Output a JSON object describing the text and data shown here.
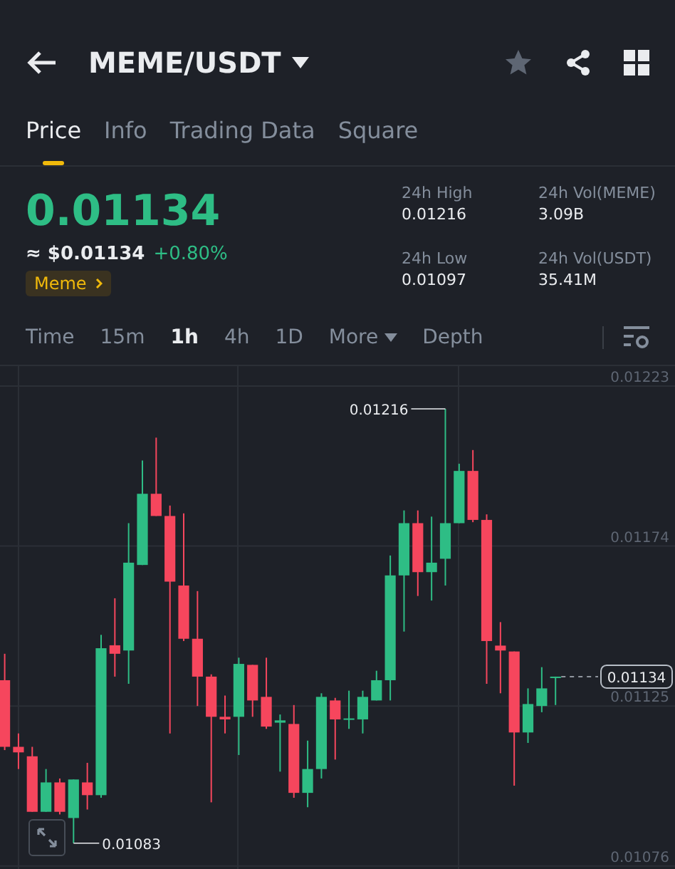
{
  "header": {
    "title": "MEME/USDT"
  },
  "tabs": [
    {
      "label": "Price",
      "selected": true
    },
    {
      "label": "Info",
      "selected": false
    },
    {
      "label": "Trading Data",
      "selected": false
    },
    {
      "label": "Square",
      "selected": false
    }
  ],
  "price": {
    "last": "0.01134",
    "usd": "≈ $0.01134",
    "change": "+0.80%",
    "tag": "Meme"
  },
  "stats": [
    {
      "label": "24h High",
      "value": "0.01216"
    },
    {
      "label": "24h Vol(MEME)",
      "value": "3.09B"
    },
    {
      "label": "24h Low",
      "value": "0.01097"
    },
    {
      "label": "24h Vol(USDT)",
      "value": "35.41M"
    }
  ],
  "intervals": [
    {
      "label": "Time",
      "kind": "interval",
      "selected": false
    },
    {
      "label": "15m",
      "kind": "interval",
      "selected": false
    },
    {
      "label": "1h",
      "kind": "interval",
      "selected": true
    },
    {
      "label": "4h",
      "kind": "interval",
      "selected": false
    },
    {
      "label": "1D",
      "kind": "interval",
      "selected": false
    },
    {
      "label": "More",
      "kind": "dropdown",
      "selected": false
    },
    {
      "label": "Depth",
      "kind": "interval",
      "selected": false
    }
  ],
  "chart": {
    "chart_data": {
      "type": "candlestick",
      "ylim": [
        0.010729,
        0.012291
      ],
      "yticks": [
        0.01223,
        0.01174,
        0.01125,
        0.01076
      ],
      "grid": true,
      "ohlc": [
        [
          0.011329,
          0.01141,
          0.011115,
          0.011125
        ],
        [
          0.011125,
          0.011166,
          0.011057,
          0.011108
        ],
        [
          0.011096,
          0.011125,
          0.010926,
          0.010926
        ],
        [
          0.010926,
          0.011057,
          0.010926,
          0.011016
        ],
        [
          0.011016,
          0.011028,
          0.010918,
          0.010926
        ],
        [
          0.010907,
          0.011025,
          0.01083,
          0.011025
        ],
        [
          0.011016,
          0.011076,
          0.010933,
          0.010977
        ],
        [
          0.010977,
          0.011468,
          0.010969,
          0.011427
        ],
        [
          0.011436,
          0.01158,
          0.01134,
          0.01141
        ],
        [
          0.01142,
          0.01181,
          0.011318,
          0.011689
        ],
        [
          0.011682,
          0.012002,
          0.011682,
          0.0119
        ],
        [
          0.0119,
          0.012072,
          0.011832,
          0.011832
        ],
        [
          0.011832,
          0.011864,
          0.011166,
          0.011631
        ],
        [
          0.011619,
          0.01184,
          0.011449,
          0.011456
        ],
        [
          0.011456,
          0.011602,
          0.01125,
          0.01134
        ],
        [
          0.01134,
          0.011347,
          0.010955,
          0.011217
        ],
        [
          0.011217,
          0.011282,
          0.011166,
          0.011209
        ],
        [
          0.011217,
          0.011398,
          0.0111,
          0.011379
        ],
        [
          0.011376,
          0.011376,
          0.011217,
          0.011267
        ],
        [
          0.011278,
          0.011398,
          0.01118,
          0.011187
        ],
        [
          0.011199,
          0.011224,
          0.011049,
          0.011206
        ],
        [
          0.011195,
          0.011253,
          0.010969,
          0.010984
        ],
        [
          0.010984,
          0.011144,
          0.01094,
          0.011057
        ],
        [
          0.011057,
          0.011289,
          0.011028,
          0.011278
        ],
        [
          0.011267,
          0.011275,
          0.011086,
          0.011209
        ],
        [
          0.011209,
          0.011297,
          0.01118,
          0.011212
        ],
        [
          0.011209,
          0.011297,
          0.011166,
          0.011278
        ],
        [
          0.011267,
          0.011358,
          0.011267,
          0.011329
        ],
        [
          0.011329,
          0.011711,
          0.011267,
          0.01165
        ],
        [
          0.01165,
          0.011849,
          0.011478,
          0.01181
        ],
        [
          0.01181,
          0.011849,
          0.011587,
          0.01166
        ],
        [
          0.01166,
          0.01183,
          0.011573,
          0.011689
        ],
        [
          0.011701,
          0.01216,
          0.011619,
          0.01181
        ],
        [
          0.01181,
          0.011992,
          0.01181,
          0.01197
        ],
        [
          0.01197,
          0.012034,
          0.011813,
          0.01182
        ],
        [
          0.01182,
          0.011837,
          0.011318,
          0.011449
        ],
        [
          0.011435,
          0.011507,
          0.011289,
          0.01142
        ],
        [
          0.011417,
          0.011417,
          0.011006,
          0.011169
        ],
        [
          0.011169,
          0.011304,
          0.011137,
          0.011256
        ],
        [
          0.01125,
          0.011369,
          0.011231,
          0.011304
        ],
        [
          0.011336,
          0.01134,
          0.011253,
          0.01134
        ]
      ],
      "annotations": [
        "0.01216",
        "0.01083",
        "0.01134"
      ]
    }
  }
}
